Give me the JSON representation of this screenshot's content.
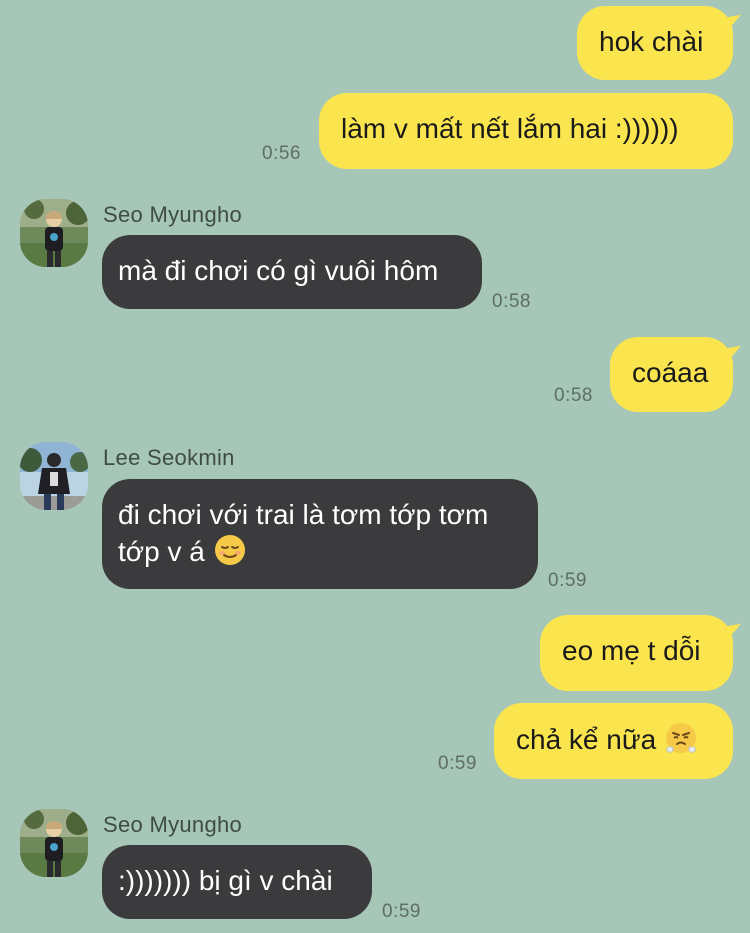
{
  "chat": {
    "messages": [
      {
        "side": "mine",
        "text": "hok chài",
        "time": ""
      },
      {
        "side": "mine",
        "text": "làm v mất nết lắm hai :))))))",
        "time": "0:56"
      },
      {
        "side": "theirs",
        "sender": "Seo Myungho",
        "text": "mà đi chơi có gì vuôi hôm",
        "time": "0:58"
      },
      {
        "side": "mine",
        "text": "coáaa",
        "time": "0:58"
      },
      {
        "side": "theirs",
        "sender": "Lee Seokmin",
        "text_line1": "đi chơi với trai là tơm tớp tơm",
        "text_line2": "tớp v á",
        "emoji": "relieved-face",
        "time": "0:59"
      },
      {
        "side": "mine",
        "text": "eo mẹ t dỗi",
        "time": ""
      },
      {
        "side": "mine",
        "text": "chả kể nữa",
        "emoji": "steam-from-nose-face",
        "time": "0:59"
      },
      {
        "side": "theirs",
        "sender": "Seo Myungho",
        "text": ":))))))) bị gì v chài",
        "time": "0:59"
      }
    ]
  },
  "colors": {
    "background": "#a6c6b8",
    "my_bubble": "#fbe54e",
    "their_bubble": "#3b3b3d",
    "timestamp": "#5e6e67"
  }
}
